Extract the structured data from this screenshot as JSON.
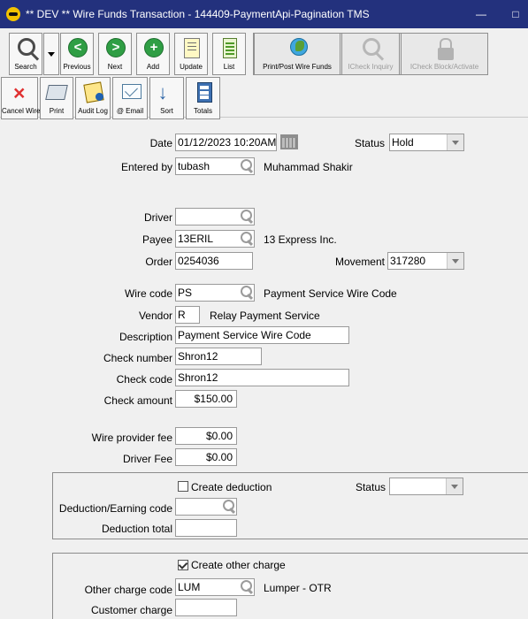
{
  "window": {
    "title": "** DEV ** Wire Funds Transaction - 144409-PaymentApi-Pagination TMS",
    "minimize": "—",
    "maximize": "□"
  },
  "toolbar": {
    "search": "Search",
    "previous": "Previous",
    "next": "Next",
    "add": "Add",
    "update": "Update",
    "list": "List",
    "print_post": "Print/Post Wire Funds",
    "icheck_inquiry": "ICheck Inquiry",
    "icheck_block": "ICheck Block/Activate",
    "cancel_wire": "Cancel Wire",
    "print": "Print",
    "audit_log": "Audit Log",
    "email": "@ Email",
    "sort": "Sort",
    "totals": "Totals"
  },
  "form": {
    "date_label": "Date",
    "date_value": "01/12/2023 10:20AM",
    "status_label": "Status",
    "status_value": "Hold",
    "entered_by_label": "Entered by",
    "entered_by_value": "tubash",
    "entered_by_name": "Muhammad Shakir",
    "driver_label": "Driver",
    "driver_value": "",
    "payee_label": "Payee",
    "payee_value": "13ERIL",
    "payee_name": "13 Express Inc.",
    "order_label": "Order",
    "order_value": "0254036",
    "movement_label": "Movement",
    "movement_value": "317280",
    "wire_code_label": "Wire code",
    "wire_code_value": "PS",
    "wire_code_desc": "Payment Service Wire Code",
    "vendor_label": "Vendor",
    "vendor_value": "R",
    "vendor_name": "Relay Payment Service",
    "description_label": "Description",
    "description_value": "Payment Service Wire Code",
    "check_number_label": "Check number",
    "check_number_value": "Shron12",
    "check_code_label": "Check code",
    "check_code_value": "Shron12",
    "check_amount_label": "Check amount",
    "check_amount_value": "$150.00",
    "wire_provider_fee_label": "Wire provider fee",
    "wire_provider_fee_value": "$0.00",
    "driver_fee_label": "Driver Fee",
    "driver_fee_value": "$0.00"
  },
  "deduction": {
    "create_label": "Create deduction",
    "status_label": "Status",
    "status_value": "",
    "code_label": "Deduction/Earning code",
    "code_value": "",
    "total_label": "Deduction total",
    "total_value": ""
  },
  "other_charge": {
    "create_label": "Create other charge",
    "code_label": "Other charge code",
    "code_value": "LUM",
    "code_desc": "Lumper - OTR",
    "customer_charge_label": "Customer charge",
    "customer_charge_value": ""
  }
}
